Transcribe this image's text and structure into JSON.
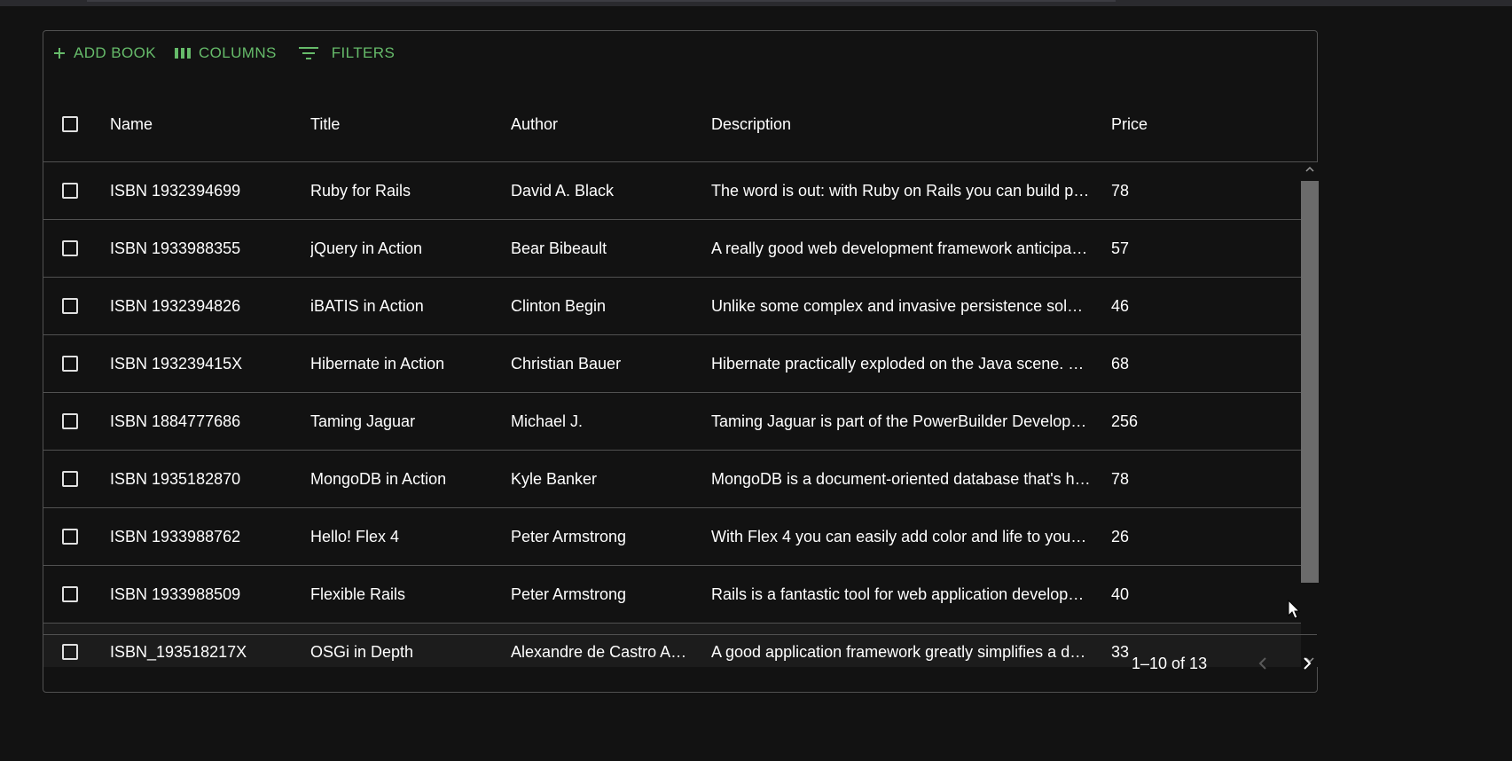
{
  "toolbar": {
    "add_label": "ADD BOOK",
    "columns_label": "COLUMNS",
    "filters_label": "FILTERS"
  },
  "columns": {
    "name": "Name",
    "title": "Title",
    "author": "Author",
    "description": "Description",
    "price": "Price"
  },
  "rows": [
    {
      "name": "ISBN 1932394699",
      "title": "Ruby for Rails",
      "author": "David A. Black",
      "description": "The word is out: with Ruby on Rails you can build p…",
      "price": "78"
    },
    {
      "name": "ISBN 1933988355",
      "title": "jQuery in Action",
      "author": "Bear Bibeault",
      "description": "A really good web development framework anticipa…",
      "price": "57"
    },
    {
      "name": "ISBN 1932394826",
      "title": "iBATIS in Action",
      "author": "Clinton Begin",
      "description": "Unlike some complex and invasive persistence sol…",
      "price": "46"
    },
    {
      "name": "ISBN 193239415X",
      "title": "Hibernate in Action",
      "author": "Christian Bauer",
      "description": "Hibernate practically exploded on the Java scene. …",
      "price": "68"
    },
    {
      "name": "ISBN 1884777686",
      "title": "Taming Jaguar",
      "author": "Michael J.",
      "description": "Taming Jaguar is part of the PowerBuilder Develop…",
      "price": "256"
    },
    {
      "name": "ISBN 1935182870",
      "title": "MongoDB in Action",
      "author": "Kyle Banker",
      "description": "MongoDB is a document-oriented database that's h…",
      "price": "78"
    },
    {
      "name": "ISBN 1933988762",
      "title": "Hello! Flex 4",
      "author": "Peter Armstrong",
      "description": "With Flex 4 you can easily add color and life to you…",
      "price": "26"
    },
    {
      "name": "ISBN 1933988509",
      "title": "Flexible Rails",
      "author": "Peter Armstrong",
      "description": "Rails is a fantastic tool for web application develop…",
      "price": "40"
    },
    {
      "name": "ISBN_193518217X",
      "title": "OSGi in Depth",
      "author": "Alexandre de Castro A…",
      "description": "A good application framework greatly simplifies a d…",
      "price": "33"
    }
  ],
  "pagination": {
    "range_text": "1–10 of 13"
  },
  "colors": {
    "accent": "#66bb6a",
    "background": "#121212",
    "border": "#515151"
  }
}
